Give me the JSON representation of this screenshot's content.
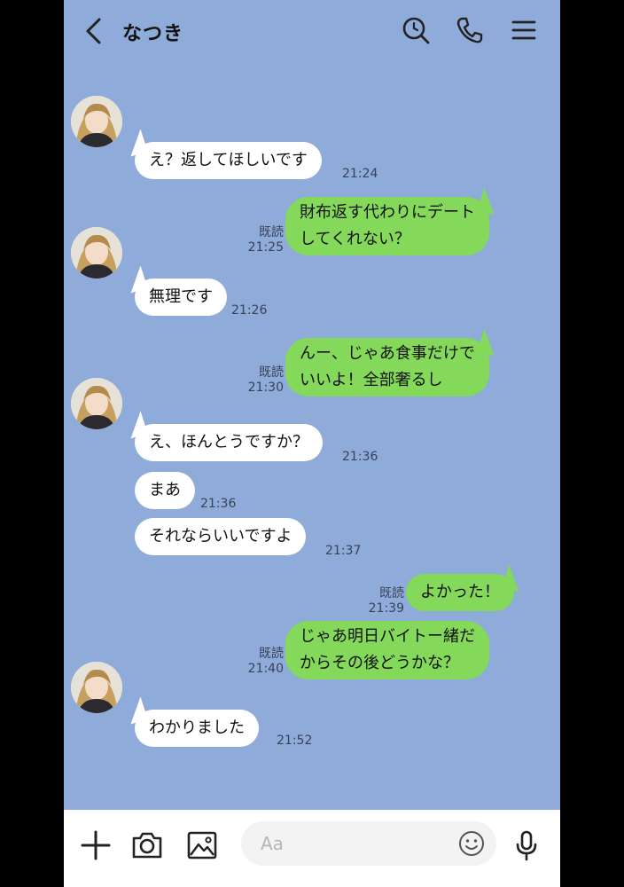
{
  "header": {
    "title": "なつき"
  },
  "messages": [
    {
      "dir": "in",
      "text": "え？返してほしいです",
      "time": "21:24"
    },
    {
      "dir": "out",
      "lines": [
        "財布返す代わりにデート",
        "してくれない？"
      ],
      "read": "既読",
      "time": "21:25"
    },
    {
      "dir": "in",
      "text": "無理です",
      "time": "21:26"
    },
    {
      "dir": "out",
      "lines": [
        "んー、じゃあ食事だけで",
        "いいよ！全部奢るし"
      ],
      "read": "既読",
      "time": "21:30"
    },
    {
      "dir": "in",
      "text": "え、ほんとうですか？",
      "time": "21:36"
    },
    {
      "dir": "in",
      "text": "まあ",
      "time": "21:36"
    },
    {
      "dir": "in",
      "text": "それならいいですよ",
      "time": "21:37"
    },
    {
      "dir": "out",
      "text": "よかった！",
      "read": "既読",
      "time": "21:39"
    },
    {
      "dir": "out",
      "lines": [
        "じゃあ明日バイトー緒だ",
        "からその後どうかな？"
      ],
      "read": "既読",
      "time": "21:40"
    },
    {
      "dir": "in",
      "text": "わかりました",
      "time": "21:52"
    }
  ],
  "composer": {
    "placeholder": "Aa"
  },
  "colors": {
    "background": "#8eabd9",
    "outgoing": "#84d85a",
    "incoming": "#ffffff"
  }
}
